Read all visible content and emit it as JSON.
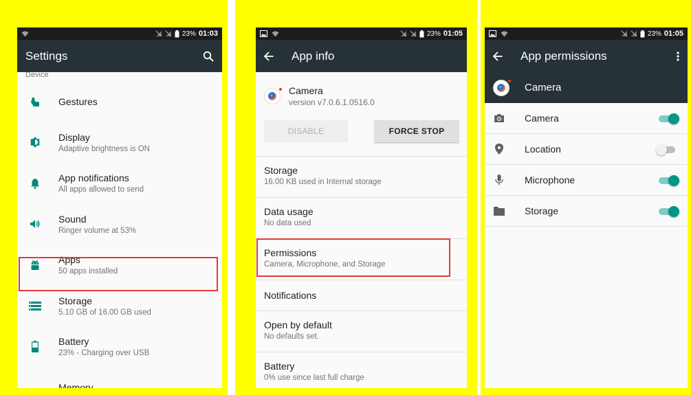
{
  "colors": {
    "frame_highlight": "#ffff00",
    "appbar": "#263238",
    "statusbar": "#1c1c1c",
    "accent_teal": "#009688",
    "selection_border": "#e53935"
  },
  "screen1": {
    "status": {
      "battery": "23%",
      "time": "01:03"
    },
    "title": "Settings",
    "section_label": "Device",
    "items": [
      {
        "icon": "gestures-icon",
        "label": "Gestures",
        "summary": ""
      },
      {
        "icon": "brightness-icon",
        "label": "Display",
        "summary": "Adaptive brightness is ON"
      },
      {
        "icon": "bell-icon",
        "label": "App notifications",
        "summary": "All apps allowed to send"
      },
      {
        "icon": "volume-icon",
        "label": "Sound",
        "summary": "Ringer volume at 53%"
      },
      {
        "icon": "android-icon",
        "label": "Apps",
        "summary": "50 apps installed",
        "highlighted": true
      },
      {
        "icon": "storage-icon",
        "label": "Storage",
        "summary": "5.10 GB of 16.00 GB used"
      },
      {
        "icon": "battery-icon",
        "label": "Battery",
        "summary": "23% - Charging over USB"
      },
      {
        "icon": "memory-icon",
        "label": "Memory",
        "summary": ""
      }
    ]
  },
  "screen2": {
    "status": {
      "battery": "23%",
      "time": "01:05"
    },
    "title": "App info",
    "app": {
      "name": "Camera",
      "version": "version v7.0.6.1.0516.0"
    },
    "buttons": {
      "disable": "DISABLE",
      "force_stop": "FORCE STOP"
    },
    "items": [
      {
        "label": "Storage",
        "summary": "16.00 KB used in Internal storage"
      },
      {
        "label": "Data usage",
        "summary": "No data used"
      },
      {
        "label": "Permissions",
        "summary": "Camera, Microphone, and Storage",
        "highlighted": true
      },
      {
        "label": "Notifications",
        "summary": ""
      },
      {
        "label": "Open by default",
        "summary": "No defaults set."
      },
      {
        "label": "Battery",
        "summary": "0% use since last full charge"
      }
    ]
  },
  "screen3": {
    "status": {
      "battery": "23%",
      "time": "01:05"
    },
    "title": "App permissions",
    "app_name": "Camera",
    "permissions": [
      {
        "icon": "camera-icon",
        "label": "Camera",
        "enabled": true
      },
      {
        "icon": "location-icon",
        "label": "Location",
        "enabled": false
      },
      {
        "icon": "microphone-icon",
        "label": "Microphone",
        "enabled": true
      },
      {
        "icon": "folder-icon",
        "label": "Storage",
        "enabled": true
      }
    ]
  }
}
